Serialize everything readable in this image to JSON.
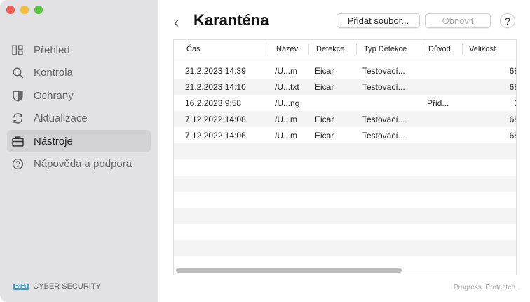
{
  "window": {
    "controls": [
      "close",
      "minimize",
      "zoom"
    ]
  },
  "sidebar": {
    "items": [
      {
        "label": "Přehled",
        "icon": "dashboard-icon"
      },
      {
        "label": "Kontrola",
        "icon": "search-icon"
      },
      {
        "label": "Ochrany",
        "icon": "shield-icon"
      },
      {
        "label": "Aktualizace",
        "icon": "refresh-icon"
      },
      {
        "label": "Nástroje",
        "icon": "toolbox-icon",
        "active": true
      },
      {
        "label": "Nápověda a podpora",
        "icon": "help-icon"
      }
    ],
    "brand_logo": "eset",
    "brand": "CYBER SECURITY"
  },
  "header": {
    "title": "Karanténa",
    "add_file": "Přidat soubor...",
    "refresh": "Obnovit",
    "help": "?"
  },
  "table": {
    "columns": [
      "Čas",
      "Název",
      "Detekce",
      "Typ Detekce",
      "Důvod",
      "Velikost"
    ],
    "rows": [
      [
        "21.2.2023 14:39",
        "/U...m",
        "Eicar",
        "Testovací...",
        "",
        "68"
      ],
      [
        "21.2.2023 14:10",
        "/U...txt",
        "Eicar",
        "Testovací...",
        "",
        "68"
      ],
      [
        "16.2.2023 9:58",
        "/U...ng",
        "",
        "",
        "Přid...",
        "1"
      ],
      [
        "7.12.2022 14:08",
        "/U...m",
        "Eicar",
        "Testovací...",
        "",
        "68"
      ],
      [
        "7.12.2022 14:06",
        "/U...m",
        "Eicar",
        "Testovací...",
        "",
        "68"
      ]
    ]
  },
  "footer": {
    "tagline": "Progress. Protected."
  }
}
